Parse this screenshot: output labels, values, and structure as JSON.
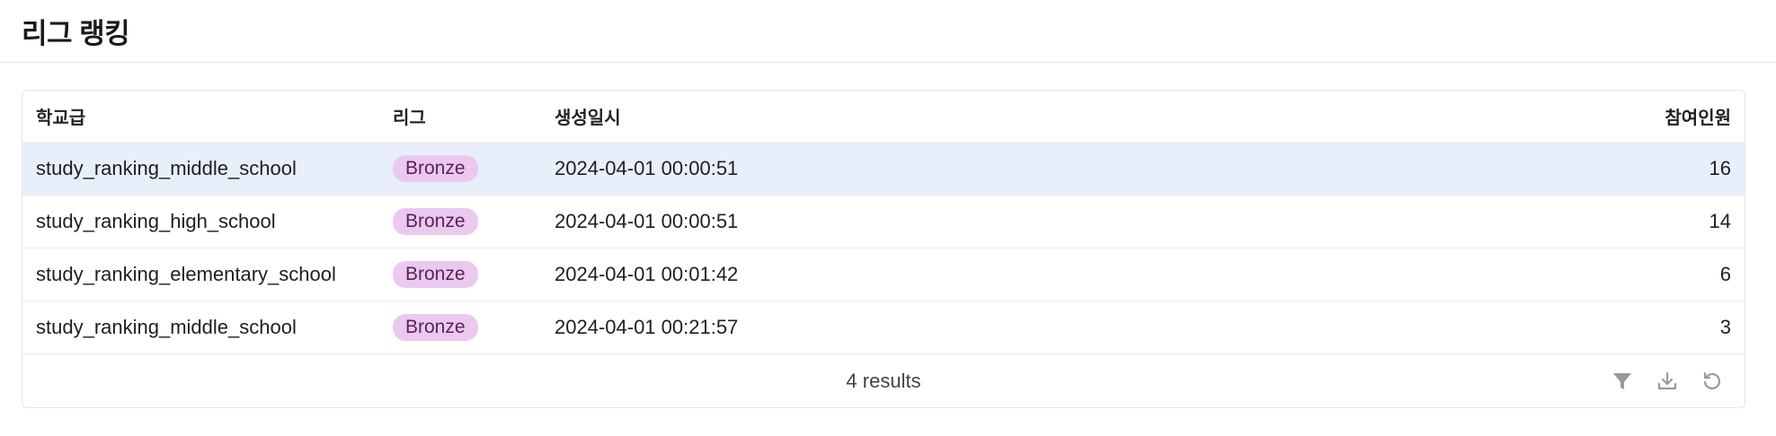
{
  "page": {
    "title": "리그 랭킹"
  },
  "table": {
    "columns": {
      "school": "학교급",
      "league": "리그",
      "created": "생성일시",
      "participants": "참여인원"
    },
    "rows": [
      {
        "school": "study_ranking_middle_school",
        "league": "Bronze",
        "created": "2024-04-01 00:00:51",
        "participants": "16",
        "selected": true
      },
      {
        "school": "study_ranking_high_school",
        "league": "Bronze",
        "created": "2024-04-01 00:00:51",
        "participants": "14",
        "selected": false
      },
      {
        "school": "study_ranking_elementary_school",
        "league": "Bronze",
        "created": "2024-04-01 00:01:42",
        "participants": "6",
        "selected": false
      },
      {
        "school": "study_ranking_middle_school",
        "league": "Bronze",
        "created": "2024-04-01 00:21:57",
        "participants": "3",
        "selected": false
      }
    ],
    "footer": {
      "results_text": "4 results",
      "icons": [
        "filter-icon",
        "download-icon",
        "refresh-icon"
      ]
    }
  },
  "colors": {
    "selected_row": "#e9eefb",
    "badge_bg": "#ebc9ee",
    "badge_text": "#5b1f5e",
    "icon_gray": "#9a9a9a"
  }
}
